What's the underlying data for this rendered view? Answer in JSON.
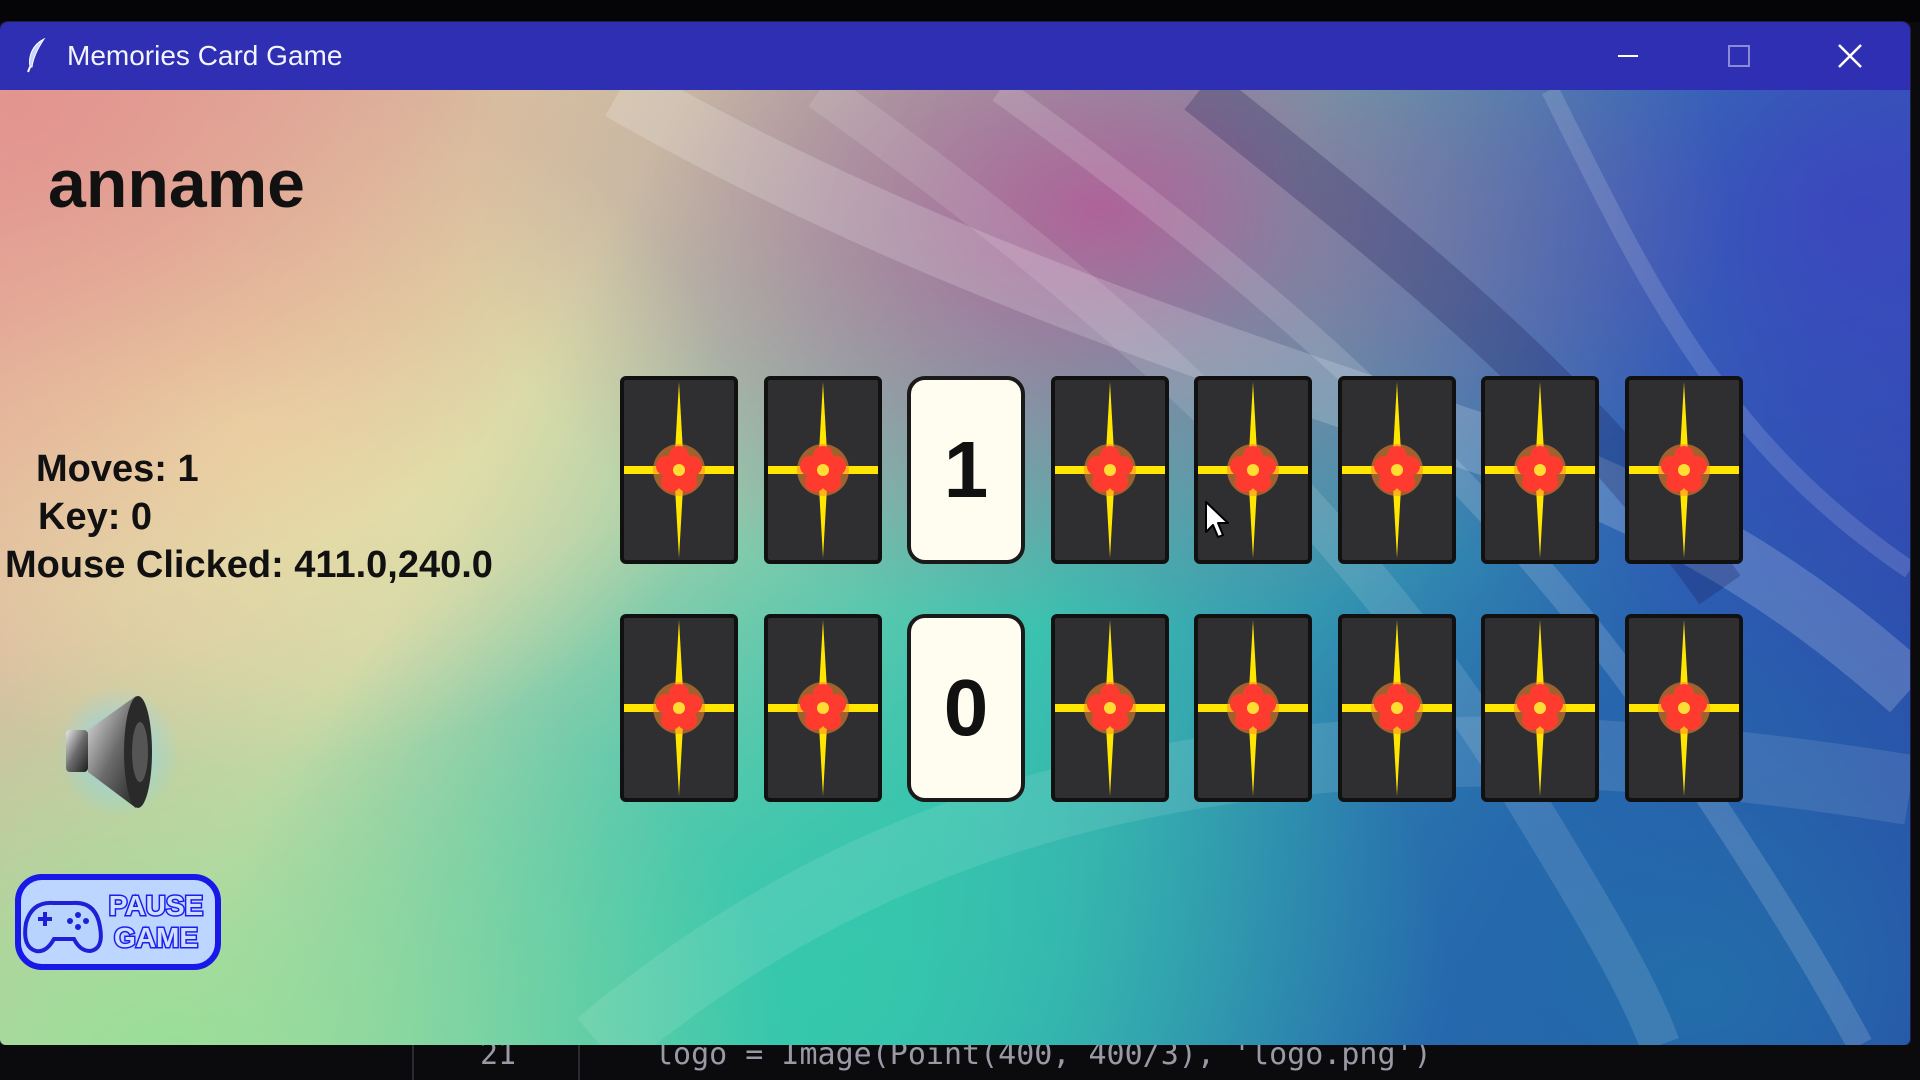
{
  "window": {
    "title": "Memories Card Game",
    "icon": "feather-icon",
    "controls": [
      "minimize-icon",
      "maximize-icon",
      "close-icon"
    ]
  },
  "game": {
    "player_name": "anname",
    "moves_text": "Moves: 1",
    "key_text": "Key: 0",
    "mouse_text": "Mouse Clicked: 411.0,240.0",
    "sound_icon": "speaker-icon",
    "pause_button": {
      "icon": "gamepad-icon",
      "line1": "PAUSE",
      "line2": "GAME"
    },
    "card_back_design": "cross-flower-card-back",
    "rows": [
      [
        {
          "revealed": false,
          "value": ""
        },
        {
          "revealed": false,
          "value": ""
        },
        {
          "revealed": true,
          "value": "1"
        },
        {
          "revealed": false,
          "value": ""
        },
        {
          "revealed": false,
          "value": ""
        },
        {
          "revealed": false,
          "value": ""
        },
        {
          "revealed": false,
          "value": ""
        },
        {
          "revealed": false,
          "value": ""
        }
      ],
      [
        {
          "revealed": false,
          "value": ""
        },
        {
          "revealed": false,
          "value": ""
        },
        {
          "revealed": true,
          "value": "0"
        },
        {
          "revealed": false,
          "value": ""
        },
        {
          "revealed": false,
          "value": ""
        },
        {
          "revealed": false,
          "value": ""
        },
        {
          "revealed": false,
          "value": ""
        },
        {
          "revealed": false,
          "value": ""
        }
      ]
    ]
  },
  "colors": {
    "titlebar": "#2e2fb2",
    "card_back": "#2f2f31",
    "card_cross": "#ffe600",
    "card_flower": "#ff3b2f",
    "card_face": "#fffdf0",
    "pause_button": "#2020ff"
  },
  "background_code": {
    "line_number": "21",
    "text": "logo = Image(Point(400, 400/3), 'logo.png')"
  }
}
